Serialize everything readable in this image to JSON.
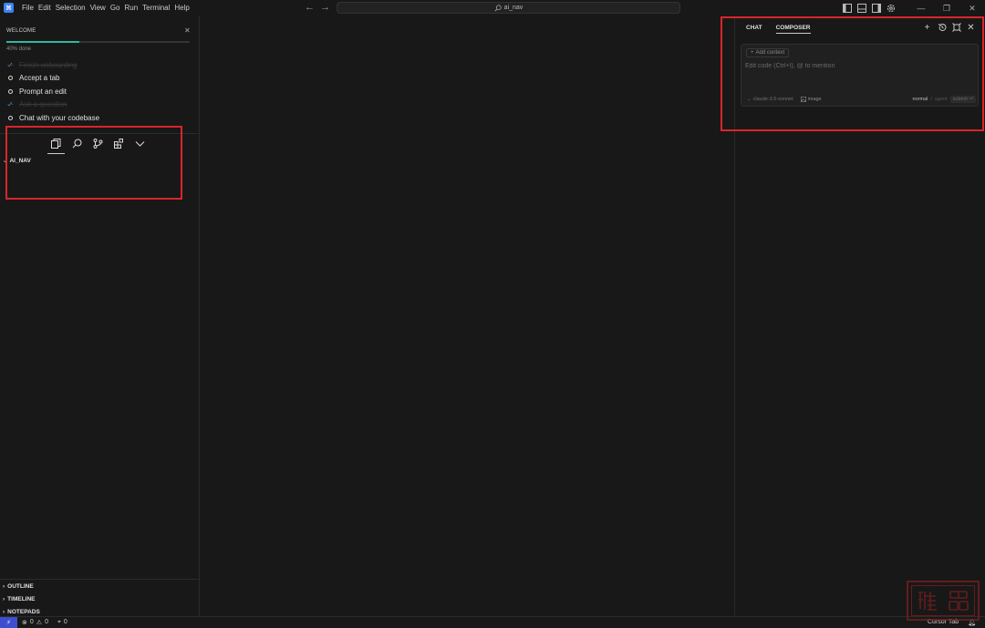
{
  "titlebar": {
    "menu": [
      "File",
      "Edit",
      "Selection",
      "View",
      "Go",
      "Run",
      "Terminal",
      "Help"
    ],
    "search_text": "ai_nav"
  },
  "welcome": {
    "title": "WELCOME",
    "progress_text": "40% done",
    "progress_value": 0.4,
    "items": [
      {
        "label": "Finish onboarding",
        "done": true
      },
      {
        "label": "Accept a tab",
        "done": false
      },
      {
        "label": "Prompt an edit",
        "done": false
      },
      {
        "label": "Ask a question",
        "done": true
      },
      {
        "label": "Chat with your codebase",
        "done": false
      }
    ]
  },
  "explorer": {
    "folder": "AI_NAV",
    "sections": [
      "OUTLINE",
      "TIMELINE",
      "NOTEPADS"
    ]
  },
  "panel": {
    "tabs": [
      "CHAT",
      "COMPOSER"
    ],
    "active_tab": "COMPOSER",
    "add_context": "Add context",
    "input_placeholder": "Edit code (Ctrl+I), @ to mention",
    "model": "claude-3.5-sonnet",
    "image_label": "image",
    "mode_normal": "normal",
    "mode_sep": "/",
    "mode_agent": "agent",
    "submit_label": "submit ⏎"
  },
  "statusbar": {
    "errors": "0",
    "warnings": "0",
    "ports": "0",
    "cursor_tab": "Cursor Tab"
  },
  "colors": {
    "accent": "#3d4fd0",
    "progress": "#2fb8a0",
    "highlight": "#d9252b"
  }
}
